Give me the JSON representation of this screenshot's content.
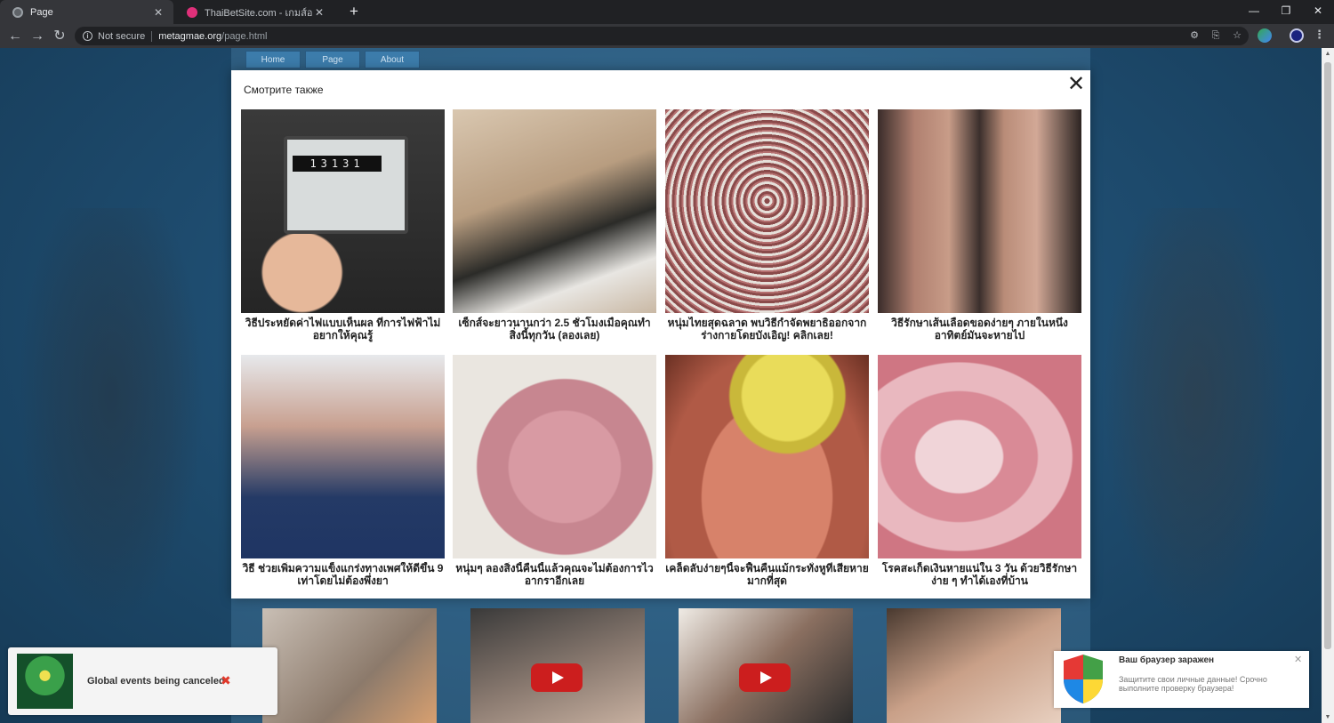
{
  "browser": {
    "tabs": [
      {
        "title": "Page",
        "active": true
      },
      {
        "title": "ThaiBetSite.com - เกมส์ออนไลน์คาสิ",
        "active": false
      }
    ],
    "address": {
      "security_label": "Not secure",
      "host": "metagmae.org",
      "path": "/page.html"
    }
  },
  "site": {
    "nav": [
      "Home",
      "Page",
      "About"
    ]
  },
  "modal": {
    "title": "Смотрите также",
    "cards": [
      {
        "caption": "วิธีประหยัดค่าไฟแบบเห็นผล ที่การไฟฟ้าไม่อยากให้คุณรู้",
        "image": "electric-meter"
      },
      {
        "caption": "เซ็กส์จะยาวนานกว่า 2.5 ชั่วโมงเมื่อคุณทำสิ่งนี้ทุกวัน (ลองเลย)",
        "image": "couple-selfie"
      },
      {
        "caption": "หนุ่มไทยสุดฉลาด พบวิธีกำจัดพยาธิออกจากร่างกายโดยบังเอิญ! คลิกเลย!",
        "image": "parasite-closeup"
      },
      {
        "caption": "วิธีรักษาเส้นเลือดขอดง่ายๆ ภายในหนึ่งอาทิตย์มันจะหายไป",
        "image": "varicose-legs"
      },
      {
        "caption": "วิธี ช่วยเพิ่มความแข็งแกร่งทางเพศให้ดีขึ้น 9 เท่าโดยไม่ต้องพึ่งยา",
        "image": "couple-portrait"
      },
      {
        "caption": "หนุ่มๆ ลองสิ่งนี้คืนนี้แล้วคุณจะไม่ต้องการไวอากราอีกเลย",
        "image": "skin-closeup"
      },
      {
        "caption": "เคล็ดลับง่ายๆนี้จะฟื้นคืนแม้กระทั่งหูที่เสียหายมากที่สุด",
        "image": "lemon-ear"
      },
      {
        "caption": "โรคสะเก็ดเงินหายแน่ใน 3 วัน ด้วยวิธีรักษาง่าย ๆ ทำได้เองที่บ้าน",
        "image": "psoriasis-arm"
      }
    ]
  },
  "notifications": {
    "left": {
      "text": "Global events being canceled",
      "close": "✖"
    },
    "right": {
      "title": "Ваш браузер заражен",
      "body": "Защитите свои личные данные! Срочно выполните проверку браузера!",
      "close": "✕"
    }
  },
  "colors": {
    "page_bg": "#1e4c6f",
    "nav_bg": "#3c7cab",
    "alert_x": "#e0392b",
    "play_red": "#cc1e1e"
  }
}
